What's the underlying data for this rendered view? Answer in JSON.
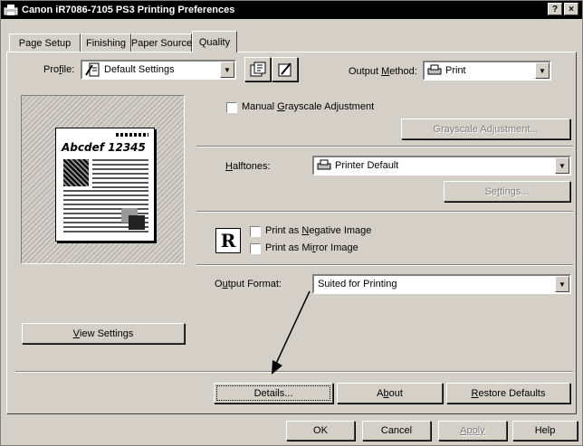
{
  "window": {
    "title": "Canon iR7086-7105 PS3 Printing Preferences",
    "help_glyph": "?",
    "close_glyph": "×"
  },
  "tabs": [
    {
      "label": "Page Setup",
      "active": false
    },
    {
      "label": "Finishing",
      "active": false
    },
    {
      "label": "Paper Source",
      "active": false
    },
    {
      "label": "Quality",
      "active": true
    }
  ],
  "profile": {
    "label_pre": "Pro",
    "label_key": "f",
    "label_post": "ile:",
    "value": "Default Settings"
  },
  "output_method": {
    "label_pre": "Output ",
    "label_key": "M",
    "label_post": "ethod:",
    "value": "Print"
  },
  "preview": {
    "sample_text": "Abcdef 12345"
  },
  "view_settings": {
    "label_key": "V",
    "label_post": "iew Settings"
  },
  "manual_grayscale": {
    "label_pre": "Manual ",
    "label_key": "G",
    "label_post": "rayscale Adjustment",
    "checked": false
  },
  "grayscale_adjustment_button": {
    "label": "Grayscale Adjustment..."
  },
  "halftones": {
    "label_key": "H",
    "label_post": "alftones:",
    "value": "Printer Default"
  },
  "settings_button": {
    "label_pre": "Se",
    "label_key": "t",
    "label_post": "tings..."
  },
  "negative_image": {
    "label_pre": "Print as ",
    "label_key": "N",
    "label_post": "egative Image",
    "checked": false
  },
  "mirror_image": {
    "label_pre": "Print as Mi",
    "label_key": "r",
    "label_post": "ror Image",
    "checked": false
  },
  "mirror_icon_glyph": "R",
  "output_format": {
    "label_pre": "O",
    "label_key": "u",
    "label_post": "tput Format:",
    "value": "Suited for Printing"
  },
  "panel_buttons": {
    "details": {
      "label": "Details..."
    },
    "about": {
      "label_pre": "A",
      "label_key": "b",
      "label_post": "out"
    },
    "restore": {
      "label_key": "R",
      "label_post": "estore Defaults"
    }
  },
  "dialog_buttons": {
    "ok": "OK",
    "cancel": "Cancel",
    "apply": "Apply",
    "help": "Help"
  }
}
